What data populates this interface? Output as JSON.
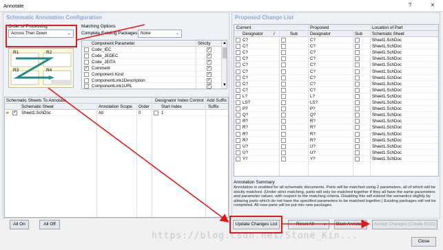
{
  "window": {
    "title": "Annotate",
    "help_label": "?",
    "close_label": "✕"
  },
  "left": {
    "title": "Schematic Annotation Configuration",
    "order": {
      "label": "Order of Processing",
      "value": "Across Then Down"
    },
    "matching": {
      "label": "Matching Options",
      "complete_label": "Complete Existing Packages",
      "complete_value": "None",
      "col_param": "Component Parameter",
      "col_strict": "Strictly",
      "rows": [
        {
          "name": "Code_IEC",
          "checked": false,
          "strict": true
        },
        {
          "name": "Code_JEDEC",
          "checked": false,
          "strict": true
        },
        {
          "name": "Code_JEITA",
          "checked": false,
          "strict": true
        },
        {
          "name": "Comment",
          "checked": true,
          "strict": true
        },
        {
          "name": "Component Kind",
          "checked": false,
          "strict": true
        },
        {
          "name": "ComponentLink1Description",
          "checked": false,
          "strict": true
        },
        {
          "name": "ComponentLink1URL",
          "checked": false,
          "strict": true
        }
      ]
    },
    "preview_labels": [
      "R1",
      "R2",
      "R3",
      "R4"
    ],
    "sheets": {
      "title": "Schematic Sheets To Annotate",
      "group_index": "Designator Index Control",
      "group_suffix": "Add Suffix",
      "col_sheet": "Schematic Sheet",
      "col_scope": "Annotation Scope",
      "col_order": "Order",
      "col_start": "Start Index",
      "col_suffix": "Suffix",
      "rows": [
        {
          "sheet": "Sheet1.SchDoc",
          "scope": "All",
          "order": "0",
          "start": "1",
          "checked": true
        }
      ]
    },
    "all_on": "All On",
    "all_off": "All Off"
  },
  "right": {
    "title": "Proposed Change List",
    "col_current": "Current",
    "col_proposed": "Proposed",
    "col_location": "Location of Part",
    "col_designator": "Designator",
    "col_sub": "Sub",
    "col_designator2": "Designator",
    "col_sub2": "Sub",
    "col_sheet": "Schematic Sheet",
    "rows": [
      {
        "cur": "C?",
        "prop": "C?",
        "sheet": "Sheet1.SchDoc"
      },
      {
        "cur": "C?",
        "prop": "C?",
        "sheet": "Sheet1.SchDoc"
      },
      {
        "cur": "C?",
        "prop": "C?",
        "sheet": "Sheet1.SchDoc"
      },
      {
        "cur": "C?",
        "prop": "C?",
        "sheet": "Sheet1.SchDoc"
      },
      {
        "cur": "C?",
        "prop": "C?",
        "sheet": "Sheet1.SchDoc"
      },
      {
        "cur": "C?",
        "prop": "C?",
        "sheet": "Sheet1.SchDoc"
      },
      {
        "cur": "C?",
        "prop": "C?",
        "sheet": "Sheet1.SchDoc"
      },
      {
        "cur": "C?",
        "prop": "C?",
        "sheet": "Sheet1.SchDoc"
      },
      {
        "cur": "C?",
        "prop": "C?",
        "sheet": "Sheet1.SchDoc"
      },
      {
        "cur": "L?",
        "prop": "L?",
        "sheet": "Sheet1.SchDoc"
      },
      {
        "cur": "LS?",
        "prop": "LS?",
        "sheet": "Sheet1.SchDoc"
      },
      {
        "cur": "P?",
        "prop": "P?",
        "sheet": "Sheet1.SchDoc"
      },
      {
        "cur": "Q?",
        "prop": "Q?",
        "sheet": "Sheet1.SchDoc"
      },
      {
        "cur": "R?",
        "prop": "R?",
        "sheet": "Sheet1.SchDoc"
      },
      {
        "cur": "R?",
        "prop": "R?",
        "sheet": "Sheet1.SchDoc"
      },
      {
        "cur": "R?",
        "prop": "R?",
        "sheet": "Sheet1.SchDoc"
      },
      {
        "cur": "R?",
        "prop": "R?",
        "sheet": "Sheet1.SchDoc"
      },
      {
        "cur": "U?",
        "prop": "U?",
        "sheet": "Sheet1.SchDoc"
      },
      {
        "cur": "U?",
        "prop": "U?",
        "sheet": "Sheet1.SchDoc"
      },
      {
        "cur": "Y?",
        "prop": "Y?",
        "sheet": "Sheet1.SchDoc"
      }
    ],
    "summary_title": "Annotation Summary",
    "summary_text": "Annotation is enabled for all schematic documents. Parts will be matched using 2 parameters, all of which will be strictly matched. (Under strict matching, parts will only be matched together if they all have the same parameters and parameter values, with respect to the matching criteria. Disabling this will extend the semantics slightly by allowing parts which do not have the specified parameters to be matched together.) Existing packages will not be completed. All new parts will be put into new packages."
  },
  "buttons": {
    "update": "Update Changes List",
    "reset": "Reset All",
    "back": "Back Annotate",
    "accept": "Accept Changes (Create ECO)",
    "close": "Close"
  },
  "watermark": "https://blog.csdn.net/Stone_Kin..."
}
